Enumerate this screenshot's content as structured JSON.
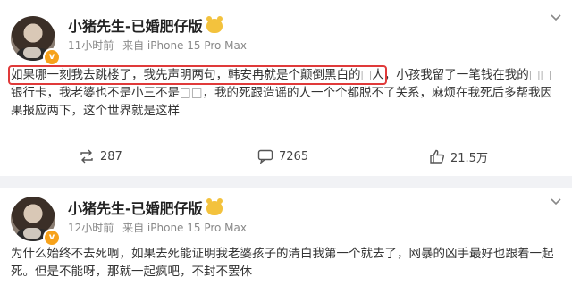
{
  "posts": [
    {
      "author": "小猪先生-已婚肥仔版",
      "meta": {
        "time": "11小时前",
        "source": "来自 iPhone 15 Pro Max"
      },
      "content_highlight": "如果哪一刻我去跳楼了，我先声明两句，韩安冉就是个颠倒黑白的",
      "content_highlight_tail": "人",
      "content_rest": "，小孩我留了一笔钱在我的",
      "content_rest2": "银行卡，我老婆也不是小三不是",
      "content_rest3": "，我的死跟造谣的人一个个都脱不了关系，麻烦在我死后多帮我因果报应两下，这个世界就是这样",
      "actions": {
        "repost": "287",
        "comments": "7265",
        "likes": "21.5万"
      }
    },
    {
      "author": "小猪先生-已婚肥仔版",
      "meta": {
        "time": "12小时前",
        "source": "来自 iPhone 15 Pro Max"
      },
      "content": "为什么始终不去死啊，如果去死能证明我老婆孩子的清白我第一个就去了，网暴的凶手最好也跟着一起死。但是不能呀，那就一起疯吧，不封不罢休"
    }
  ],
  "colors": {
    "highlight_border": "#e03a3a",
    "badge": "#f7a21b",
    "divider": "#f1f2f5"
  },
  "icons": [
    "chevron-down-icon",
    "repost-icon",
    "comment-icon",
    "like-icon",
    "verified-badge-icon",
    "member-badge-icon"
  ]
}
